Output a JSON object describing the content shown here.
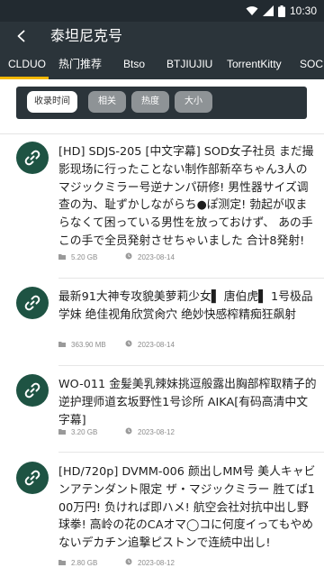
{
  "status": {
    "time": "10:30"
  },
  "header": {
    "title": "泰坦尼克号"
  },
  "tabs": [
    {
      "label": "CLDUO",
      "active": true
    },
    {
      "label": "热门推荐",
      "active": false
    },
    {
      "label": "Btso",
      "active": false
    },
    {
      "label": "BTJIUJIU",
      "active": false
    },
    {
      "label": "TorrentKitty",
      "active": false
    },
    {
      "label": "SOCI",
      "active": false
    }
  ],
  "sort": [
    {
      "label": "收录时间",
      "active": true
    },
    {
      "label": "相关",
      "active": false
    },
    {
      "label": "热度",
      "active": false
    },
    {
      "label": "大小",
      "active": false
    }
  ],
  "results": [
    {
      "title": "[HD] SDJS-205 [中文字幕] SOD女子社员 まだ撮影现场に行ったことない制作部新卒ちゃん3人のマジックミラー号逆ナンパ研修! 男性器サイズ调查の为、耻ずかしながらち●ぽ测定! 勃起が収まらなくて困っている男性を放っておけず、 あの手この手で全员発射させちゃいました 合计8発射!",
      "size": "5.20 GB",
      "date": "2023-08-14"
    },
    {
      "title": "最新91大神专攻貌美萝莉少女▌ 唐伯虎▌ 1号极品学妹 绝佳视角欣赏肏穴 绝妙快感榨精痴狂飙射",
      "size": "363.90 MB",
      "date": "2023-08-14"
    },
    {
      "title": "WO-011 金髪美乳辣妹挑逗般露出胸部榨取精子的逆护理师道玄坂野性1号诊所 AIKA[有码高清中文字幕]",
      "size": "3.20 GB",
      "date": "2023-08-12"
    },
    {
      "title": "[HD/720p] DVMM-006 颜出しMM号 美人キャビンアテンダント限定 ザ・マジックミラー 胜てば100万円! 负ければ即ハメ! 航空会社対抗中出し野球拳! 高岭の花のCAオマ◯コに何度イってもやめないデカチン追撃ピストンで连続中出し!",
      "size": "2.80 GB",
      "date": "2023-08-12"
    }
  ]
}
